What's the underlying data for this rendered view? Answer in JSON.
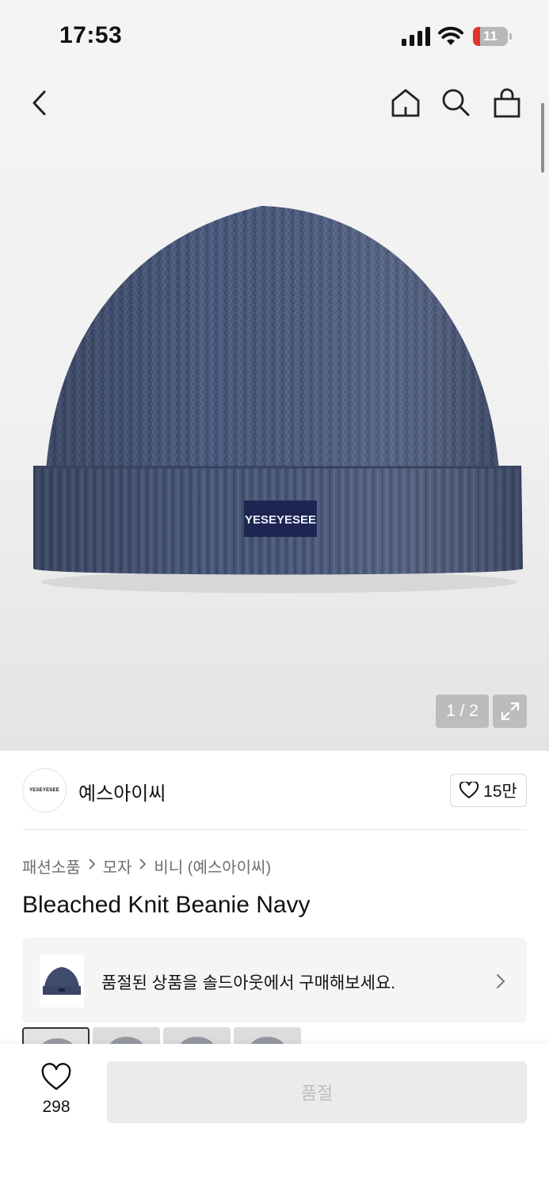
{
  "status_bar": {
    "time": "17:53",
    "battery_level": "11",
    "battery_fraction": 0.11
  },
  "nav": {
    "back_icon": "chevron-left-icon",
    "home_icon": "home-icon",
    "search_icon": "search-icon",
    "cart_icon": "shopping-bag-icon"
  },
  "image_gallery": {
    "counter": "1 / 2",
    "expand_icon": "expand-icon",
    "logo_tag": "YESEYESEE",
    "beanie_color": "#4a5a7d"
  },
  "brand": {
    "logo_text": "YESEYESEE",
    "name": "예스아이씨",
    "likes": "15만"
  },
  "breadcrumb": [
    "패션소품",
    "모자",
    "비니 (예스아이씨)"
  ],
  "product": {
    "title": "Bleached Knit Beanie Navy"
  },
  "sold_out_banner": {
    "text": "품절된 상품을 솔드아웃에서 구매해보세요."
  },
  "bottom_bar": {
    "wish_count": "298",
    "buy_label": "품절"
  },
  "colors": {
    "accent_disabled_bg": "#ebebeb",
    "accent_disabled_text": "#bdbdbd",
    "battery_low": "#e0342d"
  }
}
